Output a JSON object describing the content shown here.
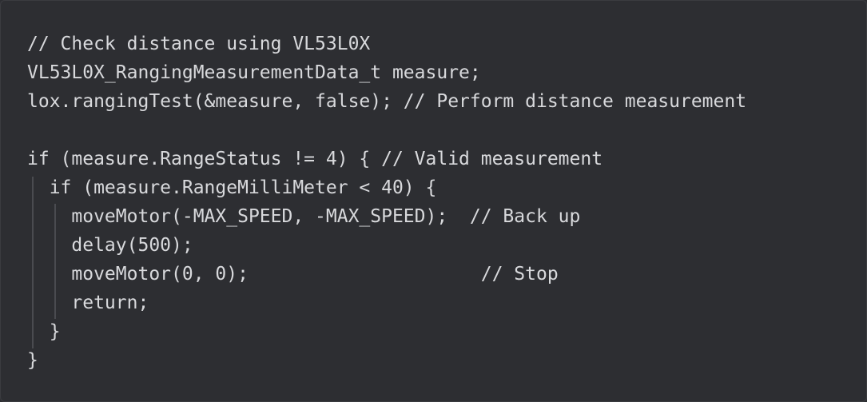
{
  "code": {
    "lines": [
      "// Check distance using VL53L0X",
      "VL53L0X_RangingMeasurementData_t measure;",
      "lox.rangingTest(&measure, false); // Perform distance measurement",
      "",
      "if (measure.RangeStatus != 4) { // Valid measurement",
      "  if (measure.RangeMilliMeter < 40) {",
      "    moveMotor(-MAX_SPEED, -MAX_SPEED);  // Back up",
      "    delay(500);",
      "    moveMotor(0, 0);                     // Stop",
      "    return;",
      "  }",
      "}"
    ]
  }
}
